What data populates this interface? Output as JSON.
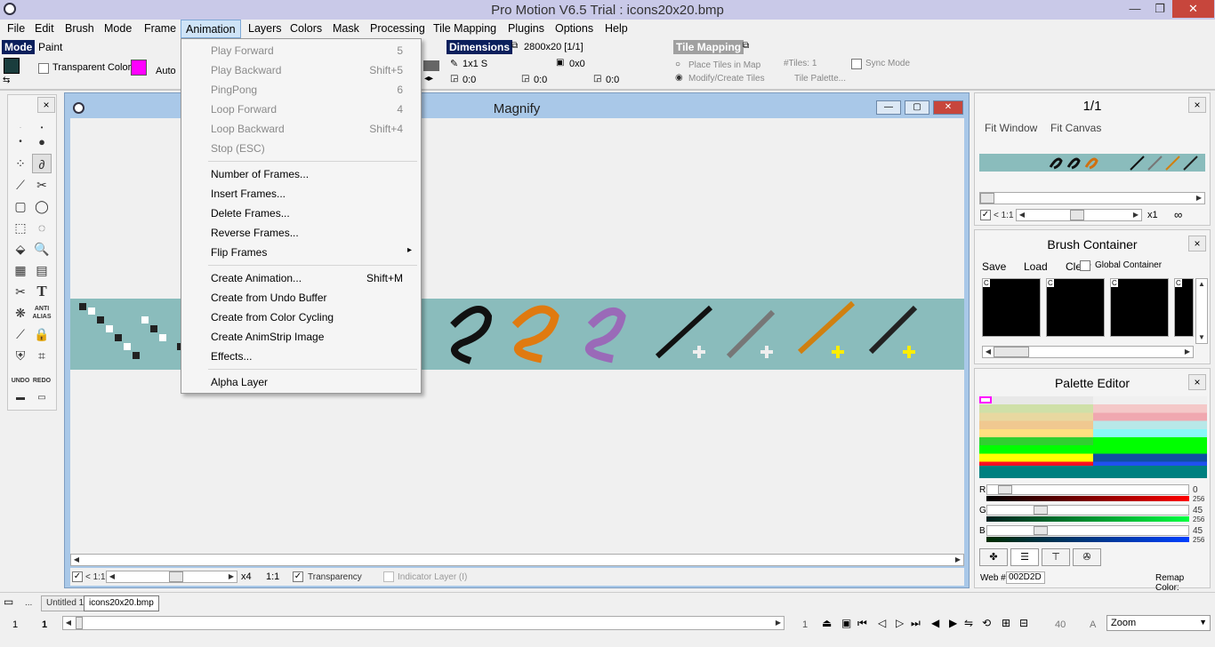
{
  "titlebar": {
    "title": "Pro Motion V6.5 Trial : icons20x20.bmp",
    "minimize": "—",
    "restore": "❐",
    "close": "✕"
  },
  "menubar": {
    "items": [
      "File",
      "Edit",
      "Brush",
      "Mode",
      "Frame",
      "Animation",
      "Layers",
      "Colors",
      "Mask",
      "Processing",
      "Tile Mapping",
      "Plugins",
      "Options",
      "Help"
    ]
  },
  "mode_panel": {
    "label": "Mode",
    "value": "Paint",
    "transparent_color_label": "Transparent Color:",
    "auto_label": "Auto",
    "fg_color": "#1a3d3d",
    "bg_color": "#ff00ff"
  },
  "dimensions_panel": {
    "label": "Dimensions",
    "size": "2800x20 [1/1]",
    "brush_size": "1x1 S",
    "offset": "0x0",
    "coord1": "0:0",
    "coord2": "0:0",
    "coord3": "0:0"
  },
  "tile_mapping_panel": {
    "label": "Tile Mapping",
    "place_tiles": "Place Tiles in Map",
    "tiles_count": "#Tiles: 1",
    "sync_mode": "Sync Mode",
    "modify_create": "Modify/Create Tiles",
    "tile_palette": "Tile Palette..."
  },
  "animation_menu": {
    "items": [
      {
        "label": "Play Forward",
        "shortcut": "5",
        "enabled": false
      },
      {
        "label": "Play Backward",
        "shortcut": "Shift+5",
        "enabled": false
      },
      {
        "label": "PingPong",
        "shortcut": "6",
        "enabled": false
      },
      {
        "label": "Loop Forward",
        "shortcut": "4",
        "enabled": false
      },
      {
        "label": "Loop Backward",
        "shortcut": "Shift+4",
        "enabled": false
      },
      {
        "label": "Stop  (ESC)",
        "shortcut": "",
        "enabled": false
      },
      {
        "label": "Number of Frames...",
        "shortcut": "",
        "enabled": true
      },
      {
        "label": "Insert Frames...",
        "shortcut": "",
        "enabled": true
      },
      {
        "label": "Delete Frames...",
        "shortcut": "",
        "enabled": true
      },
      {
        "label": "Reverse Frames...",
        "shortcut": "",
        "enabled": true
      },
      {
        "label": "Flip Frames",
        "shortcut": "▸",
        "enabled": true
      },
      {
        "label": "Create Animation...",
        "shortcut": "Shift+M",
        "enabled": true
      },
      {
        "label": "Create from Undo Buffer",
        "shortcut": "",
        "enabled": true
      },
      {
        "label": "Create from Color Cycling",
        "shortcut": "",
        "enabled": true
      },
      {
        "label": "Create AnimStrip Image",
        "shortcut": "",
        "enabled": true
      },
      {
        "label": "Effects...",
        "shortcut": "",
        "enabled": true
      },
      {
        "label": "Alpha Layer",
        "shortcut": "",
        "enabled": true
      }
    ]
  },
  "magnify": {
    "title": "Magnify",
    "zoom_ratio": "< 1:1",
    "zoom_factor": "x4",
    "scale": "1:1",
    "transparency_label": "Transparency",
    "indicator_layer_label": "Indicator Layer (I)",
    "minimize": "—",
    "maximize": "▢",
    "close": "✕"
  },
  "preview_panel": {
    "title": "1/1",
    "fit_window": "Fit Window",
    "fit_canvas": "Fit Canvas",
    "zoom_ratio": "< 1:1",
    "zoom_factor": "x1",
    "close": "×"
  },
  "brush_container": {
    "title": "Brush Container",
    "save": "Save",
    "load": "Load",
    "clear": "Clear",
    "global_container": "Global Container",
    "cell_label": "C",
    "close": "×"
  },
  "palette_editor": {
    "title": "Palette Editor",
    "r_label": "R",
    "g_label": "G",
    "b_label": "B",
    "r_value": "0",
    "g_value": "45",
    "b_value": "45",
    "max_value": "256",
    "web_label": "Web #",
    "web_value": "002D2D",
    "remap_label": "Remap Color:",
    "close": "×"
  },
  "tabs": {
    "items": [
      "Untitled 1",
      "icons20x20.bmp"
    ]
  },
  "bottom_bar": {
    "frame_left": "1",
    "frame_current": "1",
    "frame_total": "1",
    "speed": "40",
    "a_label": "A",
    "zoom_select": "Zoom",
    "ellipsis": "..."
  },
  "tool_panel": {
    "close": "×",
    "text_tool": "T",
    "anti_alias": "ANTI ALIAS",
    "undo": "UNDO",
    "redo": "REDO"
  }
}
